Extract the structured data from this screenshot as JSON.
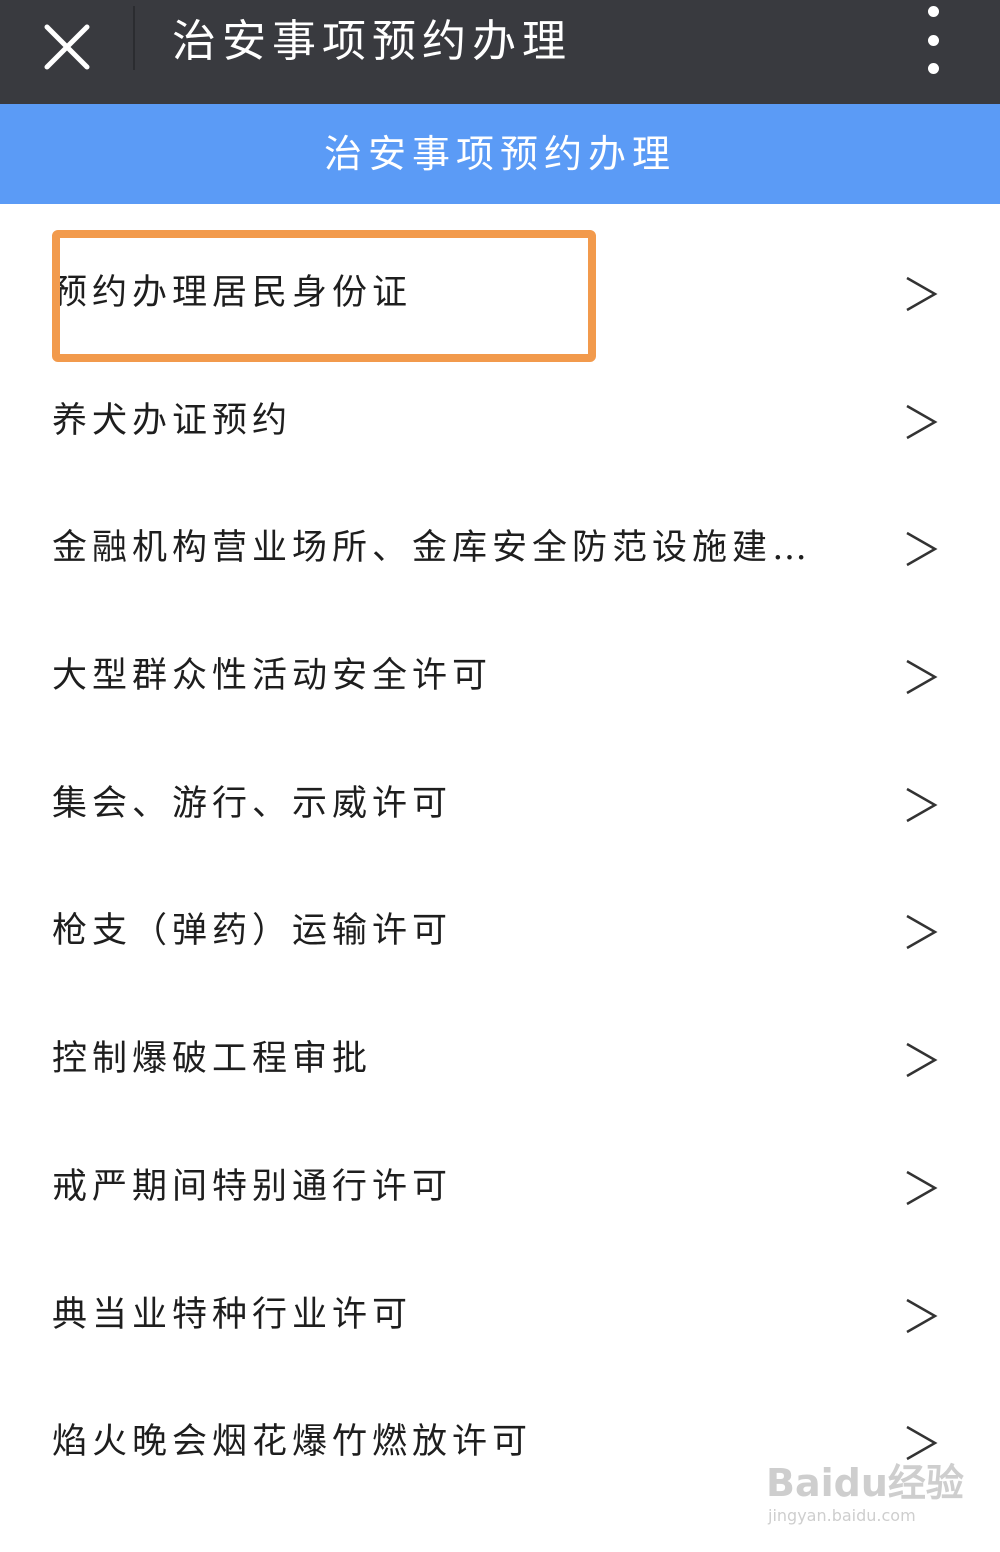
{
  "topbar": {
    "title": "治安事项预约办理",
    "close_icon": "close-icon",
    "more_icon": "more-vertical-icon",
    "background": "#393a3f"
  },
  "header": {
    "title": "治安事项预约办理",
    "background": "#5b9bf6"
  },
  "highlight": {
    "color": "#f29a4c",
    "target_item": "预约办理居民身份证"
  },
  "list": {
    "items": [
      {
        "label": "预约办理居民身份证",
        "chevron": ">"
      },
      {
        "label": "养犬办证预约",
        "chevron": ">"
      },
      {
        "label": "金融机构营业场所、金库安全防范设施建…",
        "chevron": ">"
      },
      {
        "label": "大型群众性活动安全许可",
        "chevron": ">"
      },
      {
        "label": "集会、游行、示威许可",
        "chevron": ">"
      },
      {
        "label": "枪支（弹药）运输许可",
        "chevron": ">"
      },
      {
        "label": "控制爆破工程审批",
        "chevron": ">"
      },
      {
        "label": "戒严期间特别通行许可",
        "chevron": ">"
      },
      {
        "label": "典当业特种行业许可",
        "chevron": ">"
      },
      {
        "label": "焰火晚会烟花爆竹燃放许可",
        "chevron": ">"
      }
    ]
  },
  "watermark": {
    "main": "Baidu经验",
    "sub": "jingyan.baidu.com"
  }
}
